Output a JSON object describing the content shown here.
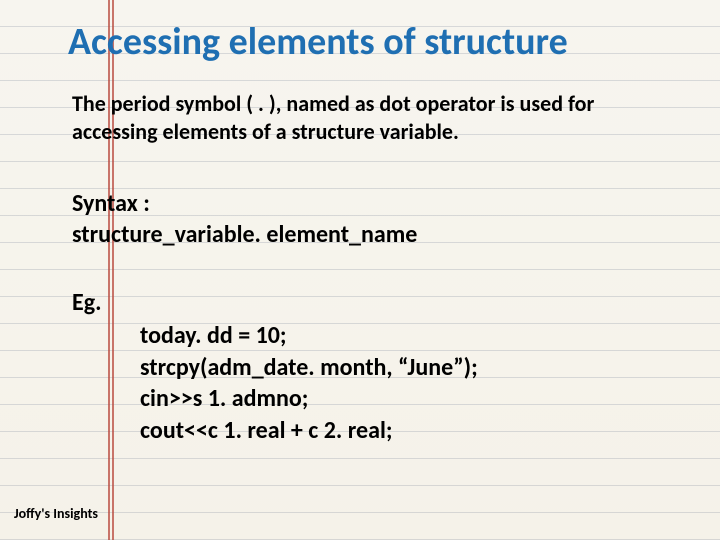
{
  "title": "Accessing elements of structure",
  "description": "The period symbol ( . ), named as dot operator is used for accessing elements of a structure variable.",
  "syntax": {
    "label": "Syntax :",
    "text": "structure_variable. element_name"
  },
  "example": {
    "label": "Eg.",
    "lines": [
      "today. dd = 10;",
      "strcpy(adm_date. month, “June”);",
      "cin>>s 1. admno;",
      "cout<<c 1. real + c 2. real;"
    ]
  },
  "footer": "Joffy's Insights"
}
